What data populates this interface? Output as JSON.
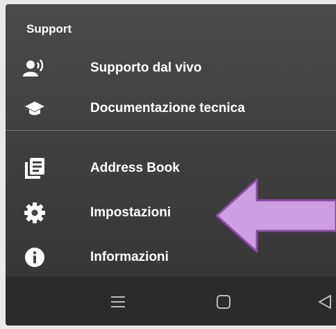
{
  "support": {
    "title": "Support",
    "items": [
      {
        "label": "Supporto dal vivo",
        "icon": "live-support-icon"
      },
      {
        "label": "Documentazione tecnica",
        "icon": "graduation-cap-icon"
      }
    ]
  },
  "menu": {
    "items": [
      {
        "label": "Address Book",
        "icon": "address-book-icon"
      },
      {
        "label": "Impostazioni",
        "icon": "gear-icon"
      },
      {
        "label": "Informazioni",
        "icon": "info-icon"
      }
    ]
  },
  "annotation": {
    "arrow_color": "#cf9ee0",
    "arrow_direction": "left",
    "target": "Impostazioni"
  },
  "navbar": {
    "buttons": [
      "menu-icon",
      "home-icon",
      "back-icon"
    ]
  },
  "colors": {
    "background": "#3f3f3f",
    "text": "#ffffff",
    "navbar": "#2b2b2b"
  }
}
